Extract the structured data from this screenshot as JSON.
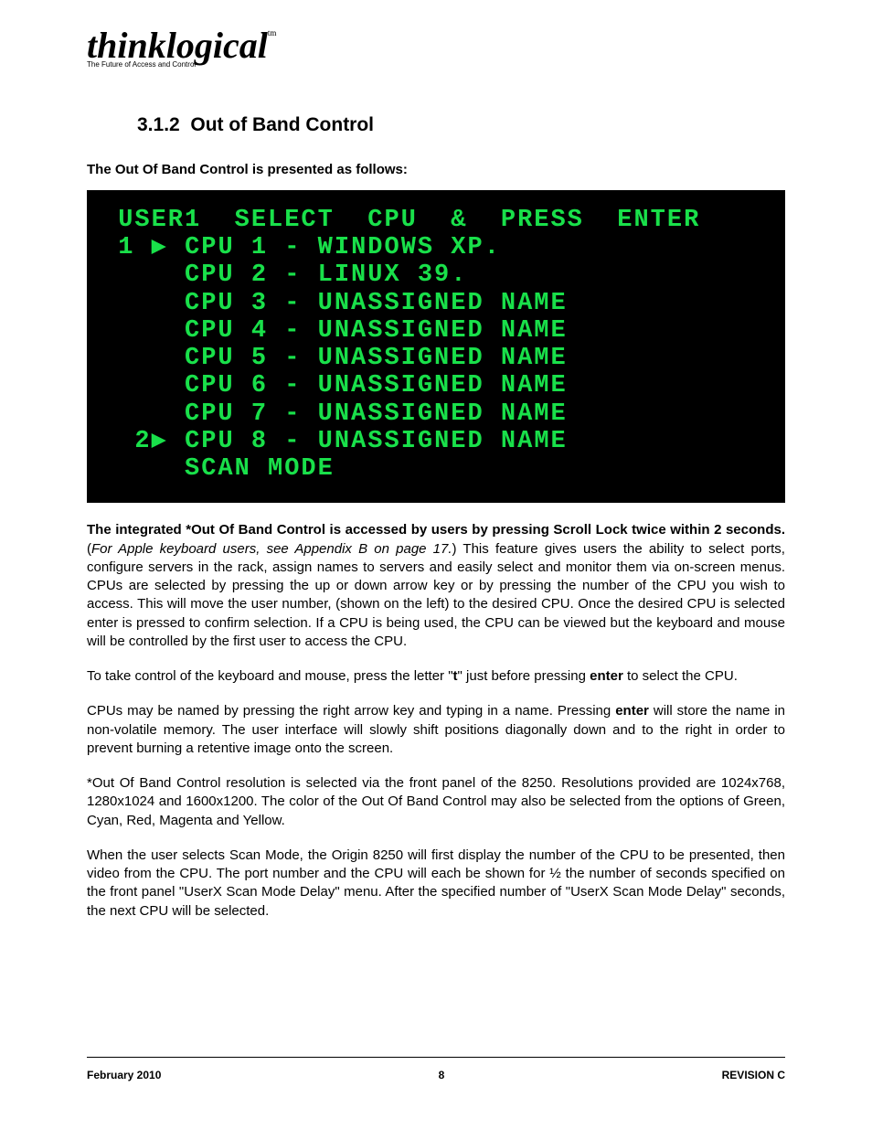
{
  "logo": {
    "name": "thinklogical",
    "tm": "tm",
    "tagline": "The Future of Access and Control"
  },
  "section": {
    "number": "3.1.2",
    "title": "Out of Band Control"
  },
  "intro": "The Out Of Band Control is presented as follows:",
  "terminal": {
    "header": "USER1  SELECT  CPU  &  PRESS  ENTER",
    "rows": [
      {
        "marker": "1 ▶",
        "label": "CPU 1 - WINDOWS XP."
      },
      {
        "marker": "   ",
        "label": "CPU 2 - LINUX 39."
      },
      {
        "marker": "   ",
        "label": "CPU 3 - UNASSIGNED NAME"
      },
      {
        "marker": "   ",
        "label": "CPU 4 - UNASSIGNED NAME"
      },
      {
        "marker": "   ",
        "label": "CPU 5 - UNASSIGNED NAME"
      },
      {
        "marker": "   ",
        "label": "CPU 6 - UNASSIGNED NAME"
      },
      {
        "marker": "   ",
        "label": "CPU 7 - UNASSIGNED NAME"
      },
      {
        "marker": " 2▶",
        "label": "CPU 8 - UNASSIGNED NAME"
      },
      {
        "marker": "   ",
        "label": "SCAN MODE"
      }
    ]
  },
  "paragraphs": {
    "p1a": "The integrated *Out Of Band Control is accessed by users by pressing Scroll Lock twice within 2 seconds.",
    "p1b": "(",
    "p1c": "For Apple keyboard users, see Appendix B on page 17.",
    "p1d": ")  This feature gives users the ability to select ports, configure servers in the rack, assign names to servers and easily select and monitor them via on-screen menus.  CPUs are selected by pressing the up or down arrow key or by pressing the number of the CPU you wish to access.  This will move the user number, (shown on the left) to the desired CPU.  Once the desired CPU is selected enter is pressed to confirm selection.  If a CPU is being used, the CPU can be viewed but the keyboard and mouse will be controlled by the first user to access the CPU.",
    "p2a": "To take control of the keyboard and mouse, press the letter \"",
    "p2b": "t",
    "p2c": "\" just before pressing ",
    "p2d": "enter",
    "p2e": " to select the CPU.",
    "p3a": "CPUs may be named by pressing the right arrow key and typing in a name.  Pressing ",
    "p3b": "enter",
    "p3c": " will store the name in non-volatile memory.  The user interface will slowly shift positions diagonally down and to the right in order to prevent burning a retentive image onto the screen.",
    "p4": "*Out Of Band Control resolution is selected via the front panel of the 8250.  Resolutions provided are 1024x768, 1280x1024 and 1600x1200.  The color of the Out Of Band Control may also be selected from the options of Green, Cyan, Red, Magenta and Yellow.",
    "p5": "When the user selects Scan Mode, the Origin 8250 will first display the number of the CPU to be presented, then video from the CPU. The port number and the CPU will each be shown for ½ the number of seconds specified on the front panel \"UserX Scan Mode Delay\" menu.  After the specified number of \"UserX Scan Mode Delay\" seconds, the next CPU will be selected."
  },
  "footer": {
    "left": "February 2010",
    "center": "8",
    "right": "REVISION C"
  }
}
